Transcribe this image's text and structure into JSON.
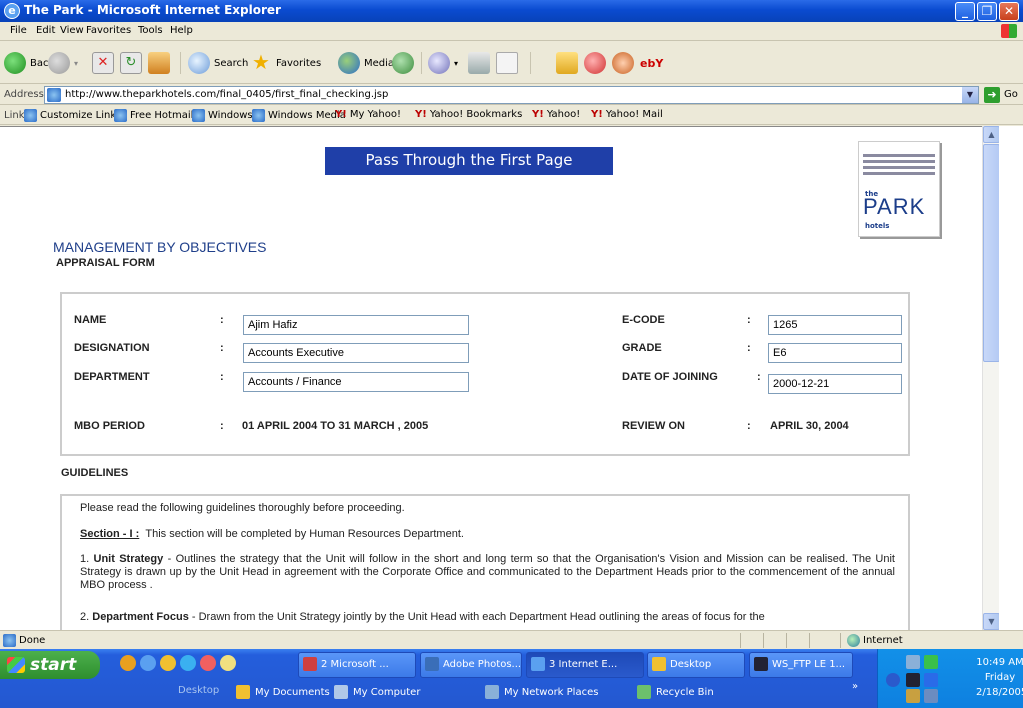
{
  "window": {
    "title": "The Park - Microsoft Internet Explorer"
  },
  "menu": [
    "File",
    "Edit",
    "View",
    "Favorites",
    "Tools",
    "Help"
  ],
  "toolbar": {
    "back": "Back",
    "search": "Search",
    "favorites": "Favorites",
    "media": "Media"
  },
  "address": {
    "label": "Address",
    "url": "http://www.theparkhotels.com/final_0405/first_final_checking.jsp",
    "go": "Go"
  },
  "links": {
    "label": "Links",
    "items": [
      "Customize Links",
      "Free Hotmail",
      "Windows",
      "Windows Media",
      "My Yahoo!",
      "Yahoo! Bookmarks",
      "Yahoo!",
      "Yahoo! Mail"
    ]
  },
  "page": {
    "banner": "Pass Through the First Page",
    "logo": {
      "the": "the",
      "park": "PARK",
      "hotels": "hotels"
    },
    "title": "MANAGEMENT BY OBJECTIVES",
    "subtitle": "APPRAISAL FORM",
    "form": {
      "name_label": "NAME",
      "name_value": "Ajim Hafiz",
      "designation_label": "DESIGNATION",
      "designation_value": "Accounts Executive",
      "department_label": "DEPARTMENT",
      "department_value": "Accounts / Finance",
      "mbo_period_label": "MBO  PERIOD",
      "mbo_period_value": "01 APRIL 2004 TO 31 MARCH , 2005",
      "ecode_label": "E-CODE",
      "ecode_value": "1265",
      "grade_label": "GRADE",
      "grade_value": "E6",
      "doj_label": "DATE OF JOINING",
      "doj_value": "2000-12-21",
      "review_label": "REVIEW ON",
      "review_value": "APRIL 30, 2004",
      "colon": ":"
    },
    "guidelines": {
      "heading": "GUIDELINES",
      "intro": "Please read the following guidelines thoroughly before proceeding.",
      "section_label": "Section - I :",
      "section_text": "This section will be completed by Human Resources Department.",
      "item1_num": "1.",
      "item1_title": "Unit Strategy",
      "item1_text": "- Outlines the strategy that the Unit will follow in the short and long term so that the Organisation's Vision and Mission can be realised. The Unit Strategy is drawn up by the Unit Head in agreement with the Corporate Office and communicated to the Department Heads prior to the commencement of the annual MBO process .",
      "item2_num": "2.",
      "item2_title": "Department Focus",
      "item2_text": "- Drawn from the Unit Strategy jointly by the Unit Head with each Department Head outlining the areas of focus for the"
    }
  },
  "status": {
    "text": "Done",
    "zone": "Internet"
  },
  "taskbar": {
    "start": "start",
    "tasks": [
      "2 Microsoft ...",
      "Adobe Photos...",
      "3 Internet E...",
      "Desktop",
      "WS_FTP LE 1..."
    ],
    "desktop_bar": [
      "Desktop",
      "My Documents",
      "My Computer",
      "My Network Places",
      "Recycle Bin"
    ],
    "clock": {
      "time": "10:49 AM",
      "day": "Friday",
      "date": "2/18/2005"
    },
    "chevron": "»"
  },
  "colors": {
    "banner": "#1F3FA8",
    "title": "#1F3F8A",
    "taskbar": "#2458D0"
  }
}
